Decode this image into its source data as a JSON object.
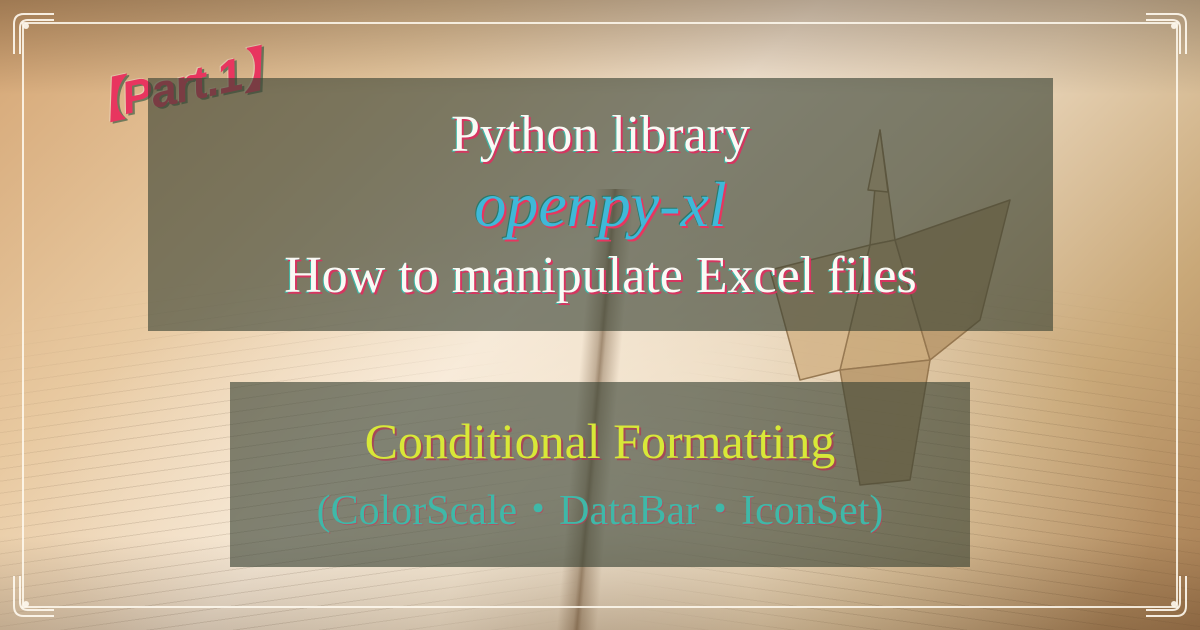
{
  "badge": {
    "text": "【Part.1】"
  },
  "panel_top": {
    "line1": "Python library",
    "line2": "openpy-xl",
    "line3": "How to manipulate Excel files"
  },
  "panel_bottom": {
    "line1": "Conditional Formatting",
    "line2": "(ColorScale・DataBar・IconSet)"
  },
  "colors": {
    "accent_pink": "#e8355f",
    "accent_cyan": "#3fb8d8",
    "accent_lime": "#d8e838",
    "accent_teal": "#3fb8a8",
    "panel_bg": "rgba(55,65,50,0.62)"
  }
}
